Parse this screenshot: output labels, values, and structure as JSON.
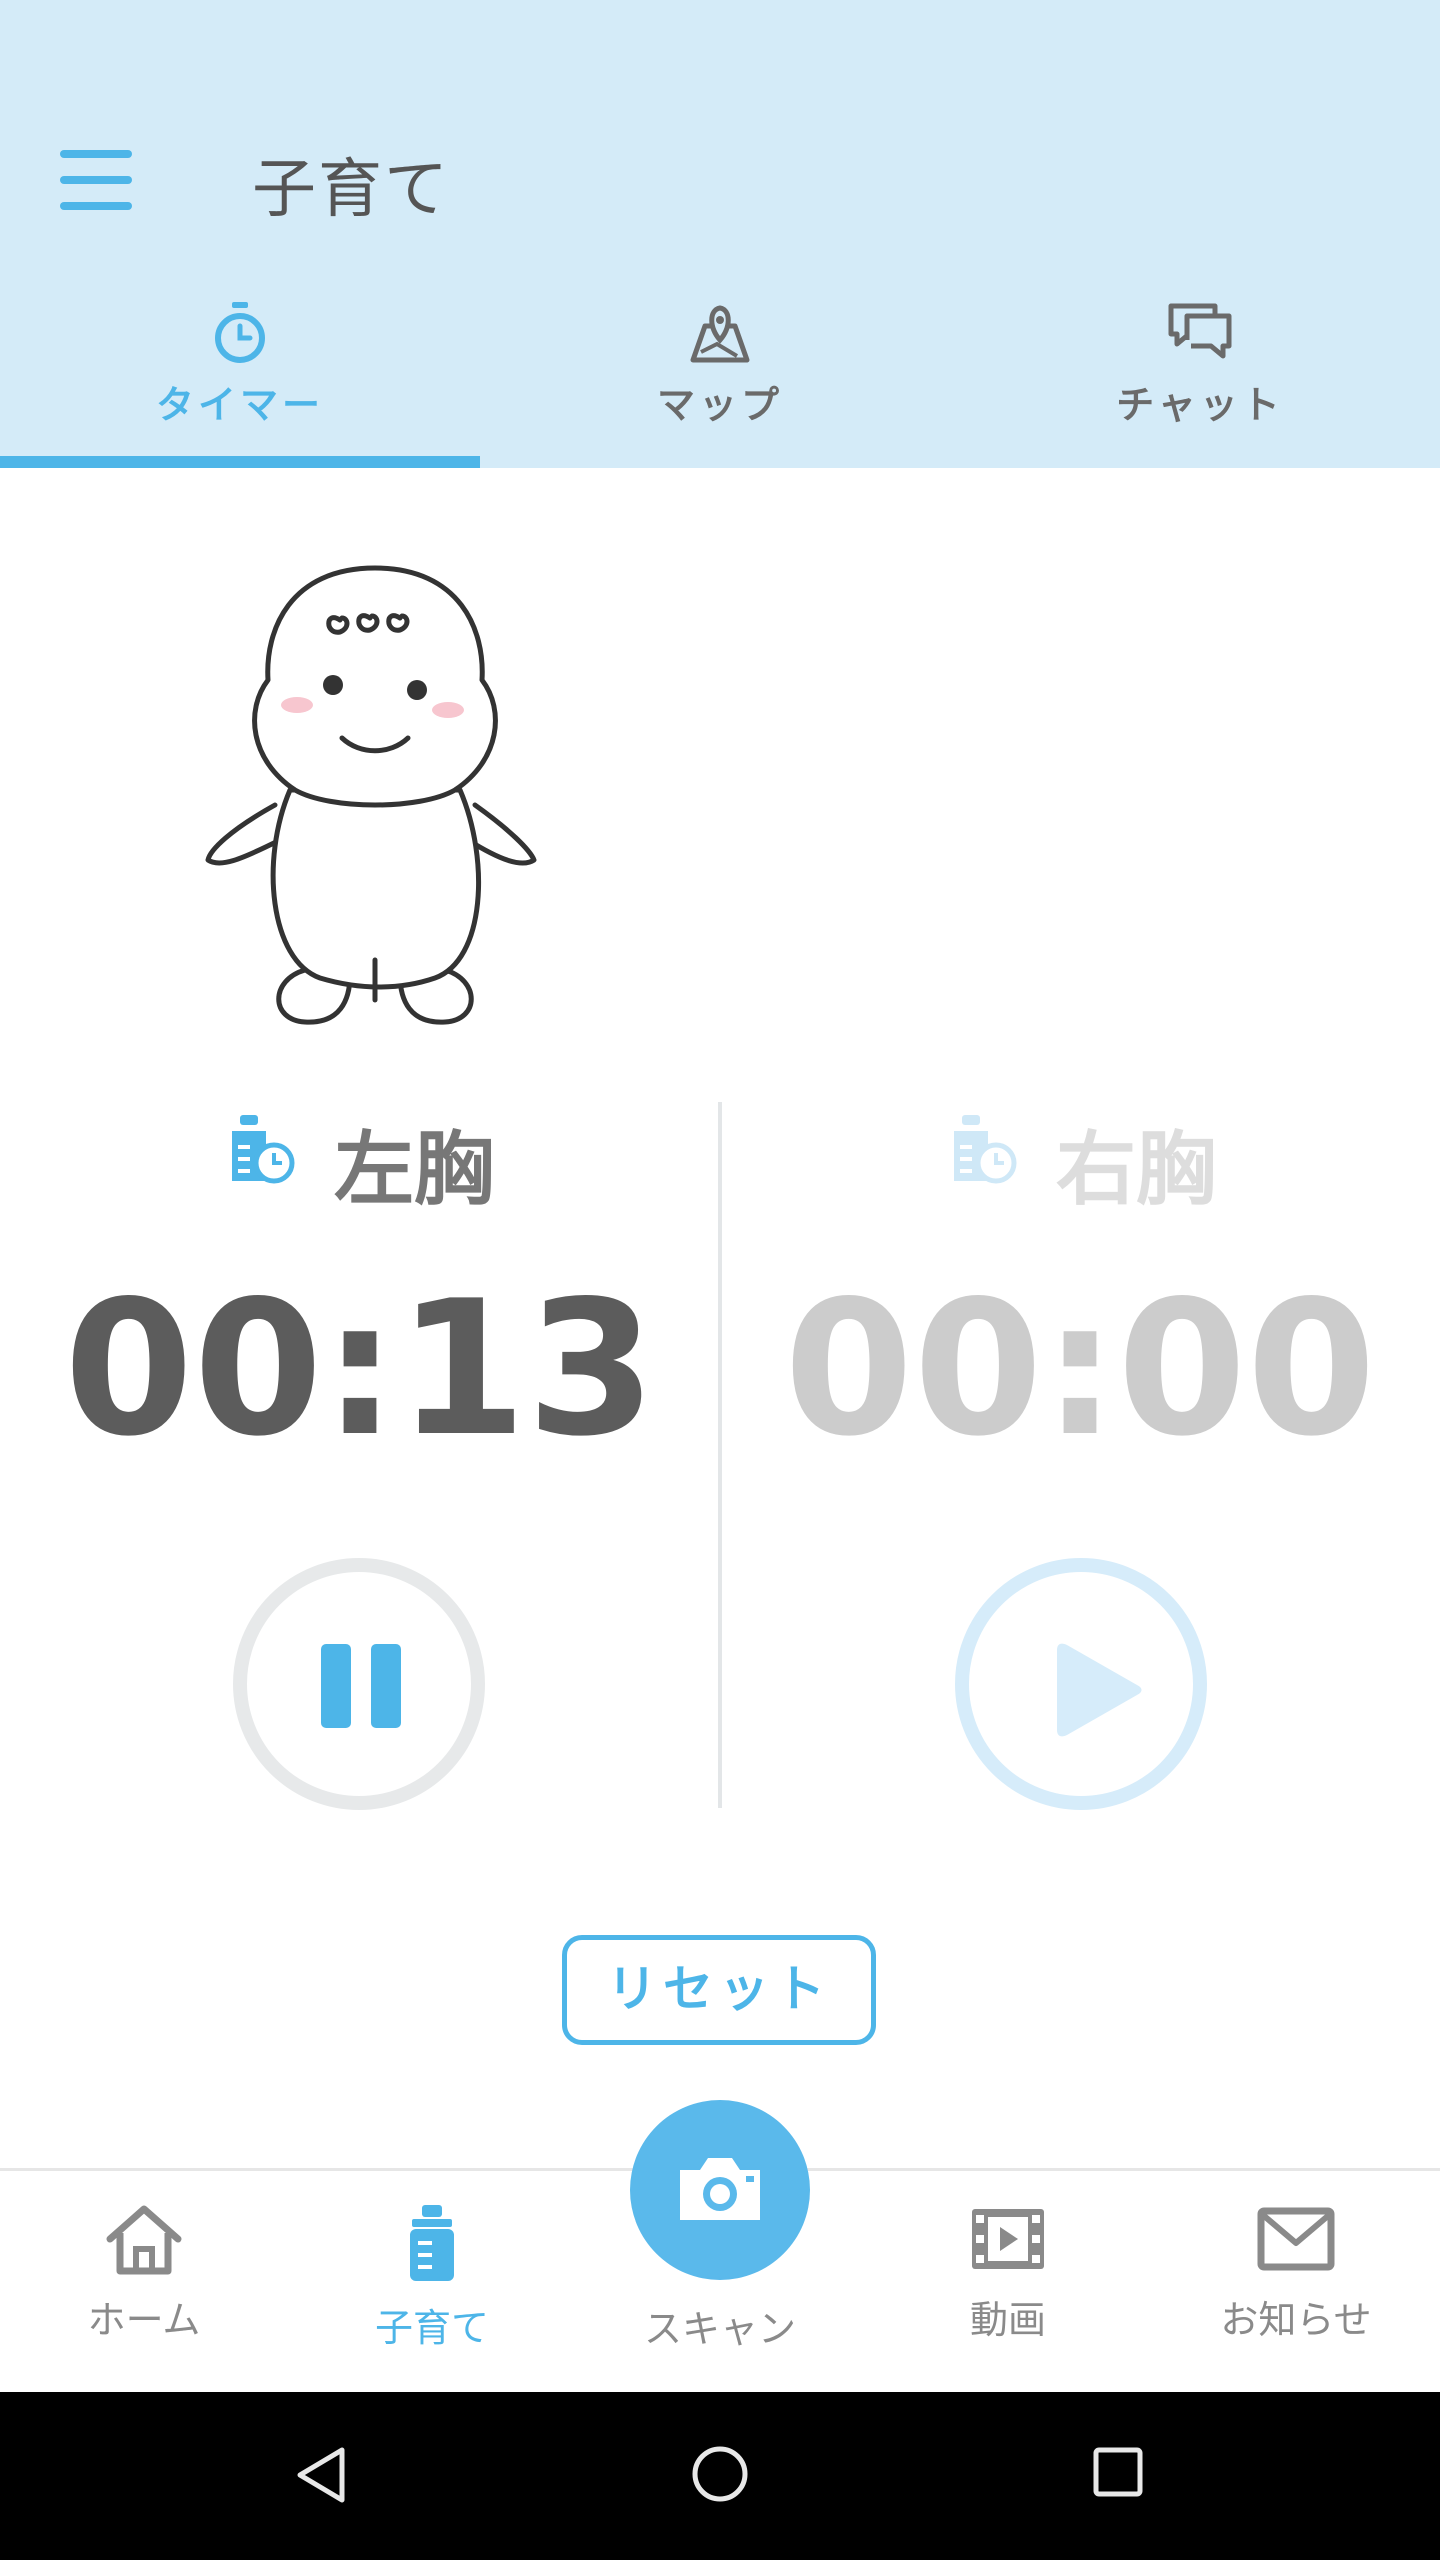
{
  "app": {
    "title": "子育て"
  },
  "tabs": [
    {
      "label": "タイマー",
      "icon": "stopwatch-icon",
      "active": true
    },
    {
      "label": "マップ",
      "icon": "map-pin-icon",
      "active": false
    },
    {
      "label": "チャット",
      "icon": "chat-icon",
      "active": false
    }
  ],
  "timer": {
    "left": {
      "label": "左胸",
      "time": "00:13",
      "state": "running",
      "control_icon": "pause-icon"
    },
    "right": {
      "label": "右胸",
      "time": "00:00",
      "state": "idle",
      "control_icon": "play-icon"
    },
    "reset_label": "リセット"
  },
  "bottom_nav": [
    {
      "label": "ホーム",
      "icon": "home-icon",
      "active": false
    },
    {
      "label": "子育て",
      "icon": "baby-bottle-icon",
      "active": true
    },
    {
      "label": "スキャン",
      "icon": "camera-icon",
      "active": false
    },
    {
      "label": "動画",
      "icon": "film-icon",
      "active": false
    },
    {
      "label": "お知らせ",
      "icon": "mail-icon",
      "active": false
    }
  ],
  "colors": {
    "accent": "#4db5e8",
    "header_bg": "#d4ebf8",
    "active_text": "#606060",
    "inactive_text": "#cccccc"
  }
}
